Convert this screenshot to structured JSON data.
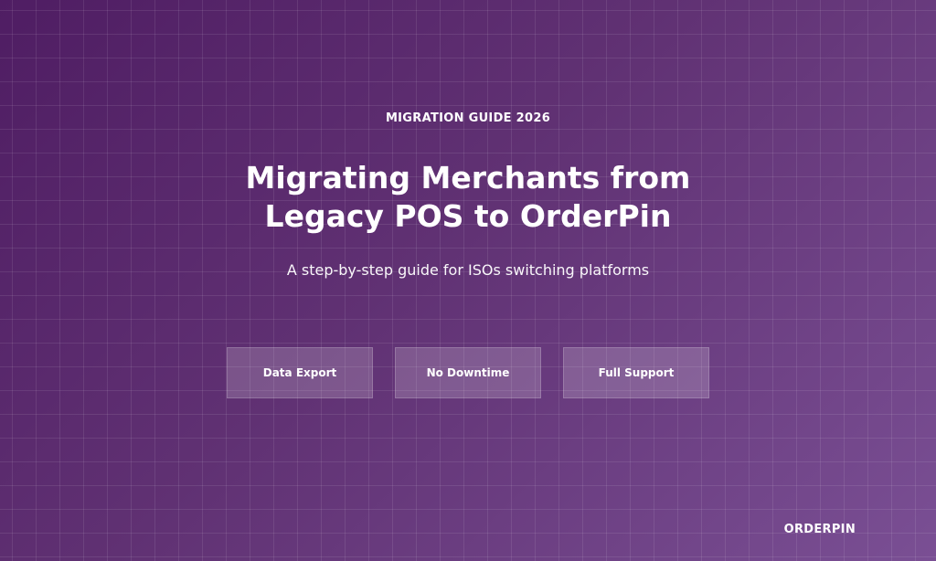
{
  "hero": {
    "eyebrow": "MIGRATION GUIDE 2026",
    "title": "Migrating Merchants from Legacy POS to OrderPin",
    "subtitle": "A step-by-step guide for ISOs switching platforms"
  },
  "pills": [
    {
      "label": "Data Export"
    },
    {
      "label": "No Downtime"
    },
    {
      "label": "Full Support"
    }
  ],
  "brand": {
    "name": "ORDERPIN"
  },
  "colors": {
    "gradient_start": "#4f1d63",
    "gradient_mid": "#603173",
    "gradient_end": "#7a4f94"
  }
}
